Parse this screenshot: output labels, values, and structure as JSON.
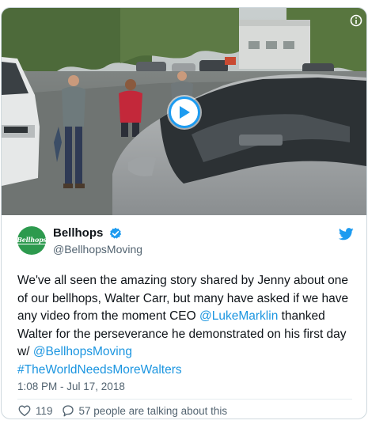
{
  "media": {
    "play_icon": "play-icon",
    "info_icon": "info-icon"
  },
  "author": {
    "avatar_text": "Bellhops",
    "display_name": "Bellhops",
    "handle": "@BellhopsMoving",
    "verified_icon": "verified-badge-icon",
    "platform_icon": "twitter-bird-icon"
  },
  "tweet": {
    "text_part1": "We've all seen the amazing story shared by Jenny about one of our bellhops, Walter Carr, but many have asked if we have any video from the moment CEO ",
    "mention1": "@LukeMarklin",
    "text_part2": " thanked Walter for the perseverance he demonstrated on his first day w/ ",
    "mention2": "@BellhopsMoving",
    "hashtag": "#TheWorldNeedsMoreWalters",
    "timestamp": "1:08 PM - Jul 17, 2018"
  },
  "actions": {
    "like_count": "119",
    "reply_text": "57 people are talking about this",
    "like_icon": "heart-icon",
    "reply_icon": "speech-bubble-icon"
  },
  "colors": {
    "link": "#1b95e0",
    "text": "#0f1419",
    "secondary": "#536471",
    "accent": "#1d9bf0",
    "avatar_bg": "#2d9a4e"
  }
}
